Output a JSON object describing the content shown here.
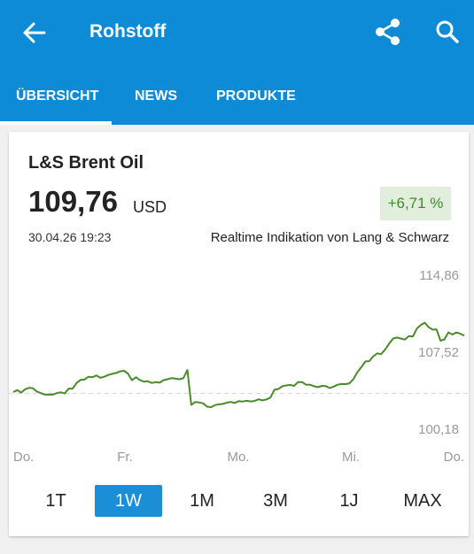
{
  "header": {
    "title": "Rohstoff",
    "icons": [
      "arrow-left-icon",
      "share-icon",
      "search-icon"
    ],
    "background_color": "#0e8bd6"
  },
  "tabs": [
    {
      "label": "ÜBERSICHT",
      "active": true
    },
    {
      "label": "NEWS",
      "active": false
    },
    {
      "label": "PRODUKTE",
      "active": false
    }
  ],
  "instrument": {
    "name": "L&S Brent Oil",
    "price": "109,76",
    "currency": "USD",
    "change": "+6,71 %",
    "timestamp": "30.04.26 19:23",
    "source": "Realtime Indikation von Lang & Schwarz",
    "change_color": "#3d8b2f"
  },
  "chart_data": {
    "type": "line",
    "x_tick_labels": [
      "Do.",
      "Fr.",
      "Mo.",
      "Mi.",
      "Do."
    ],
    "y_tick_labels": [
      "114,86",
      "107,52",
      "100,18"
    ],
    "ylim": [
      100.18,
      114.86
    ],
    "reference_line": 103.6,
    "line_color": "#4a8a2c",
    "series": [
      {
        "values": [
          103.72,
          103.91,
          103.67,
          103.99,
          104.13,
          104.09,
          103.76,
          103.61,
          103.48,
          103.49,
          103.48,
          103.62,
          103.7,
          103.59,
          104.05,
          104.05,
          104.58,
          104.89,
          104.91,
          105.18,
          105.13,
          105.31,
          105.08,
          105.18,
          105.35,
          105.45,
          105.55,
          105.7,
          105.75,
          105.48,
          104.85,
          105.13,
          104.87,
          104.72,
          104.75,
          104.59,
          104.67,
          104.62,
          104.86,
          104.95,
          105.05,
          105.0,
          104.95,
          105.05,
          105.82,
          102.5,
          102.78,
          102.73,
          102.64,
          102.33,
          102.28,
          102.48,
          102.55,
          102.59,
          102.71,
          102.78,
          102.68,
          102.86,
          102.82,
          102.89,
          102.83,
          102.87,
          103.03,
          102.93,
          103.02,
          103.2,
          103.94,
          104.01,
          104.27,
          104.36,
          104.4,
          104.31,
          104.68,
          104.68,
          104.42,
          104.42,
          104.28,
          104.19,
          104.31,
          104.29,
          104.1,
          104.25,
          104.42,
          104.49,
          104.48,
          104.56,
          104.96,
          105.62,
          106.1,
          106.64,
          106.67,
          107.12,
          107.41,
          107.34,
          107.78,
          108.33,
          108.82,
          108.92,
          108.82,
          108.73,
          109.06,
          109.01,
          109.76,
          110.12,
          110.34,
          109.91,
          109.67,
          109.7,
          108.62,
          108.75,
          109.41,
          109.21,
          109.4,
          109.28,
          109.11
        ]
      }
    ],
    "grid": false
  },
  "ranges": [
    {
      "label": "1T",
      "active": false
    },
    {
      "label": "1W",
      "active": true
    },
    {
      "label": "1M",
      "active": false
    },
    {
      "label": "3M",
      "active": false
    },
    {
      "label": "1J",
      "active": false
    },
    {
      "label": "MAX",
      "active": false
    }
  ]
}
